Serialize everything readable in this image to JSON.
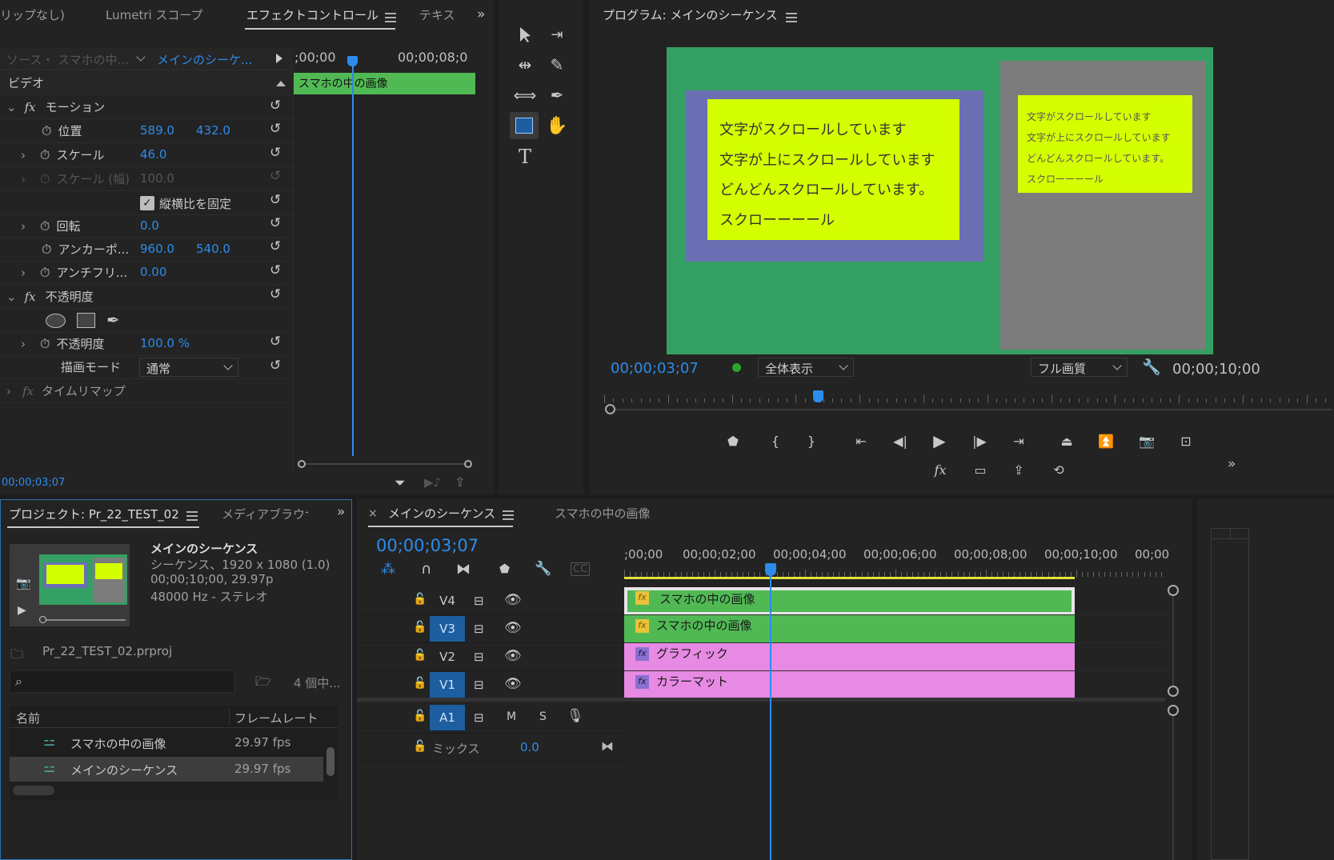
{
  "effect_controls": {
    "tabs": [
      "リップなし)",
      "Lumetri スコープ",
      "エフェクトコントロール",
      "テキス"
    ],
    "source_label": "ソース・ スマホの中...",
    "sequence_label": "メインのシーケ...",
    "time_ruler_start": ";00;00",
    "time_ruler_end": "00;00;08;0",
    "clip_name": "スマホの中の画像",
    "section_video": "ビデオ",
    "motion_label": "モーション",
    "position_label": "位置",
    "position_x": "589.0",
    "position_y": "432.0",
    "scale_label": "スケール",
    "scale_value": "46.0",
    "scale_width_label": "スケール (幅)",
    "scale_width_value": "100.0",
    "uniform_scale_label": "縦横比を固定",
    "rotation_label": "回転",
    "rotation_value": "0.0",
    "anchor_label": "アンカーポ...",
    "anchor_x": "960.0",
    "anchor_y": "540.0",
    "antiflicker_label": "アンチフリ...",
    "antiflicker_value": "0.00",
    "opacity_section_label": "不透明度",
    "opacity_label": "不透明度",
    "opacity_value": "100.0 %",
    "blend_label": "描画モード",
    "blend_value": "通常",
    "time_remap_label": "タイムリマップ",
    "timecode": "00;00;03;07"
  },
  "program_monitor": {
    "title": "プログラム: メインのシーケンス",
    "timecode": "00;00;03;07",
    "zoom": "全体表示",
    "quality": "フル画質",
    "duration": "00;00;10;00",
    "preview_lines_left": [
      "文字がスクロールしています",
      "文字が上にスクロールしています",
      "どんどんスクロールしています。",
      "スクローーーール"
    ],
    "preview_lines_right": [
      "文字がスクロールしています",
      "文字が上にスクロールしています",
      "どんどんスクロールしています。",
      "スクローーーール"
    ],
    "colors": {
      "green": "#35a063",
      "purple": "#6a6fb4",
      "yellow": "#d4ff00",
      "gray": "#7c7c7c"
    }
  },
  "project": {
    "title": "プロジェクト: Pr_22_TEST_02",
    "tab2": "メディアブラウザ",
    "seq_name": "メインのシーケンス",
    "seq_info": [
      "シーケンス、1920 x 1080 (1.0)",
      "00;00;10;00, 29.97p",
      "48000 Hz - ステレオ"
    ],
    "project_file": "Pr_22_TEST_02.prproj",
    "item_count": "4 個中...",
    "columns": [
      "名前",
      "フレームレート"
    ],
    "items": [
      {
        "name": "スマホの中の画像",
        "fps": "29.97 fps"
      },
      {
        "name": "メインのシーケンス",
        "fps": "29.97 fps"
      }
    ]
  },
  "timeline": {
    "tab": "メインのシーケンス",
    "tab2": "スマホの中の画像",
    "timecode": "00;00;03;07",
    "ruler": [
      ";00;00",
      "00;00;02;00",
      "00;00;04;00",
      "00;00;06;00",
      "00;00;08;00",
      "00;00;10;00",
      "00;00"
    ],
    "tracks": [
      {
        "name": "V4",
        "on": false,
        "clip": "スマホの中の画像",
        "type": "green"
      },
      {
        "name": "V3",
        "on": true,
        "clip": "スマホの中の画像",
        "type": "green"
      },
      {
        "name": "V2",
        "on": false,
        "clip": "グラフィック",
        "type": "pink"
      },
      {
        "name": "V1",
        "on": true,
        "clip": "カラーマット",
        "type": "pink"
      }
    ],
    "audio_track": "A1",
    "audio_m": "M",
    "audio_s": "S",
    "mix_label": "ミックス",
    "mix_value": "0.0",
    "fx_label": "fx"
  }
}
